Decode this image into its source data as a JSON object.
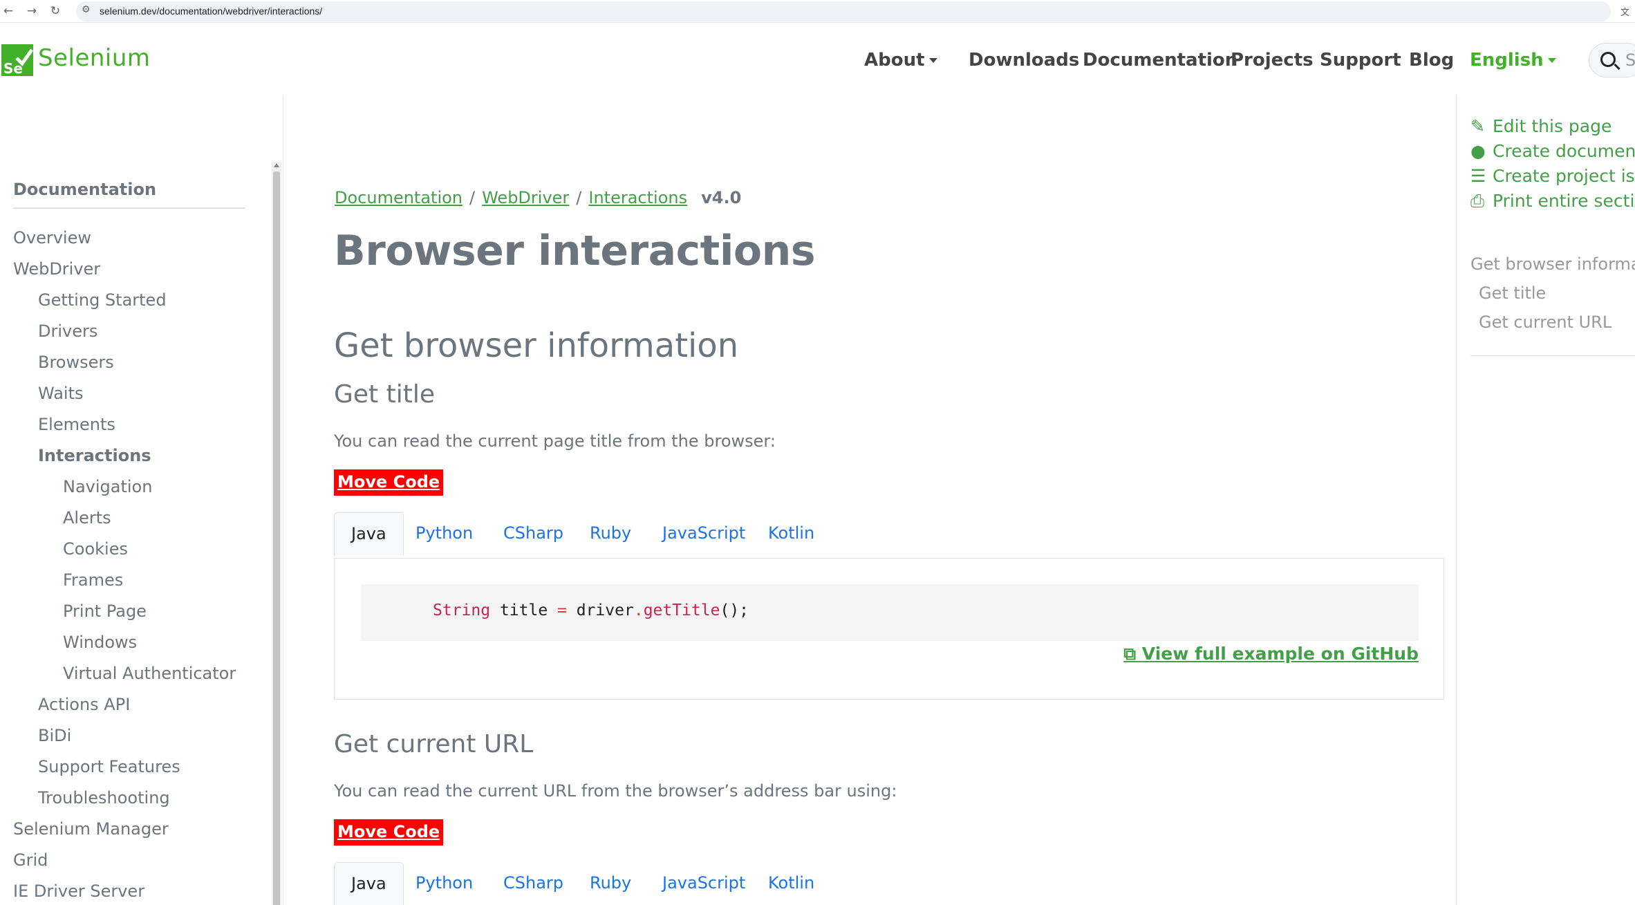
{
  "browser": {
    "url": "selenium.dev/documentation/webdriver/interactions/"
  },
  "brand": {
    "name": "Selenium",
    "logo_text": "Se"
  },
  "nav": {
    "about": "About",
    "downloads": "Downloads",
    "documentation": "Documentation",
    "projects": "Projects",
    "support": "Support",
    "blog": "Blog",
    "language": "English",
    "search_placeholder": "S"
  },
  "sidebar": {
    "title": "Documentation",
    "items": [
      {
        "label": "Overview"
      },
      {
        "label": "WebDriver"
      },
      {
        "label": "Getting Started"
      },
      {
        "label": "Drivers"
      },
      {
        "label": "Browsers"
      },
      {
        "label": "Waits"
      },
      {
        "label": "Elements"
      },
      {
        "label": "Interactions"
      },
      {
        "label": "Navigation"
      },
      {
        "label": "Alerts"
      },
      {
        "label": "Cookies"
      },
      {
        "label": "Frames"
      },
      {
        "label": "Print Page"
      },
      {
        "label": "Windows"
      },
      {
        "label": "Virtual Authenticator"
      },
      {
        "label": "Actions API"
      },
      {
        "label": "BiDi"
      },
      {
        "label": "Support Features"
      },
      {
        "label": "Troubleshooting"
      },
      {
        "label": "Selenium Manager"
      },
      {
        "label": "Grid"
      },
      {
        "label": "IE Driver Server"
      }
    ]
  },
  "breadcrumb": {
    "items": [
      "Documentation",
      "WebDriver",
      "Interactions"
    ],
    "separator": "/",
    "version": "v4.0"
  },
  "main": {
    "title": "Browser interactions",
    "section1": "Get browser information",
    "sub1": "Get title",
    "sub1_text": "You can read the current page title from the browser:",
    "move_code": "Move Code",
    "tabs": [
      "Java",
      "Python",
      "CSharp",
      "Ruby",
      "JavaScript",
      "Kotlin"
    ],
    "code": {
      "type": "String",
      "var": " title ",
      "eq": "=",
      "obj": " driver",
      "dot": ".",
      "method": "getTitle",
      "rest": "();"
    },
    "github_link": "View full example on GitHub",
    "sub2": "Get current URL",
    "sub2_text": "You can read the current URL from the browser’s address bar using:"
  },
  "right": {
    "links": [
      {
        "label": "Edit this page",
        "icon": "edit-icon"
      },
      {
        "label": "Create documentat",
        "icon": "github-icon"
      },
      {
        "label": "Create project issue",
        "icon": "tasks-icon"
      },
      {
        "label": "Print entire section",
        "icon": "print-icon"
      }
    ],
    "toc": [
      "Get browser informatio",
      "Get title",
      "Get current URL"
    ]
  },
  "colors": {
    "accent": "#43b02a",
    "link": "#1a73e8",
    "move_code_bg": "#ff0000"
  }
}
